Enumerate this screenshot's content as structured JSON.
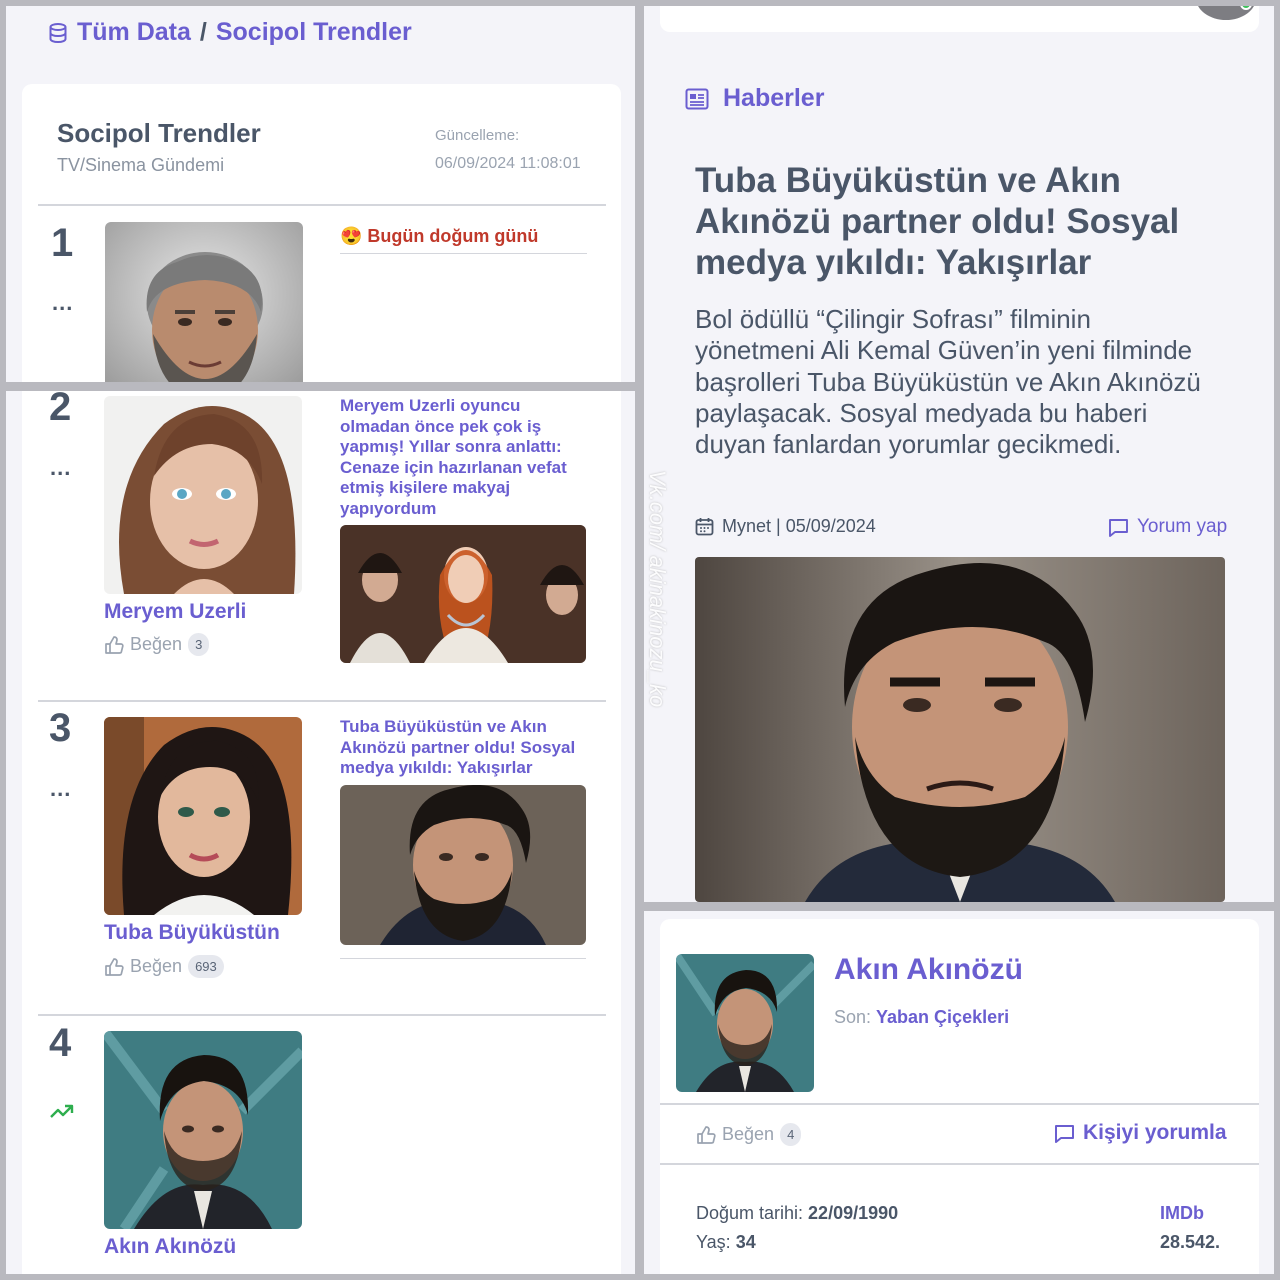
{
  "breadcrumb": {
    "root": "Tüm Data",
    "separator": "/",
    "current": "Socipol Trendler"
  },
  "trends_card": {
    "title": "Socipol Trendler",
    "subtitle": "TV/Sinema Gündemi",
    "update_label": "Güncelleme:",
    "update_time": "06/09/2024 11:08:01"
  },
  "rows": [
    {
      "rank": "1",
      "marker": "...",
      "event": "Bugün doğum günü",
      "event_emoji": "😍"
    },
    {
      "rank": "2",
      "marker": "...",
      "name": "Meryem Uzerli",
      "like_label": "Beğen",
      "likes": "3",
      "news": "Meryem Uzerli oyuncu olmadan önce pek çok iş yapmış! Yıllar sonra anlattı: Cenaze için hazırlanan vefat etmiş kişilere makyaj yapıyordum"
    },
    {
      "rank": "3",
      "marker": "...",
      "name": "Tuba Büyüküstün",
      "like_label": "Beğen",
      "likes": "693",
      "news": "Tuba Büyüküstün ve Akın Akınözü partner oldu! Sosyal medya yıkıldı: Yakışırlar"
    },
    {
      "rank": "4",
      "trend_icon": "trending-up-icon",
      "name": "Akın Akınözü"
    }
  ],
  "news_panel": {
    "section_title": "Haberler",
    "headline": "Tuba Büyüküstün ve Akın Akınözü partner oldu! Sosyal medya yıkıldı: Yakışırlar",
    "summary": "Bol ödüllü “Çilingir Sofrası” filminin yönetmeni Ali Kemal Güven’in yeni filminde başrolleri Tuba Büyüküstün ve Akın Akınözü paylaşacak. Sosyal medyada bu haberi duyan fanlardan yorumlar gecikmedi.",
    "source": "Mynet | 05/09/2024",
    "comment_label": "Yorum yap"
  },
  "watermark": "Vk.com/ akinakinozu_ko",
  "person_card": {
    "name": "Akın Akınözü",
    "last_label": "Son:",
    "last_value": "Yaban Çiçekleri",
    "like_label": "Beğen",
    "likes": "4",
    "comment_label": "Kişiyi yorumla",
    "birth_label": "Doğum tarihi:",
    "birth_value": "22/09/1990",
    "age_label": "Yaş:",
    "age_value": "34",
    "imdb_label": "IMDb",
    "imdb_value": "28.542."
  },
  "colors": {
    "accent": "#6a5ed0",
    "text": "#4a5668",
    "muted": "#9aa3b0",
    "event": "#c0392b",
    "trend": "#2eae4e"
  }
}
